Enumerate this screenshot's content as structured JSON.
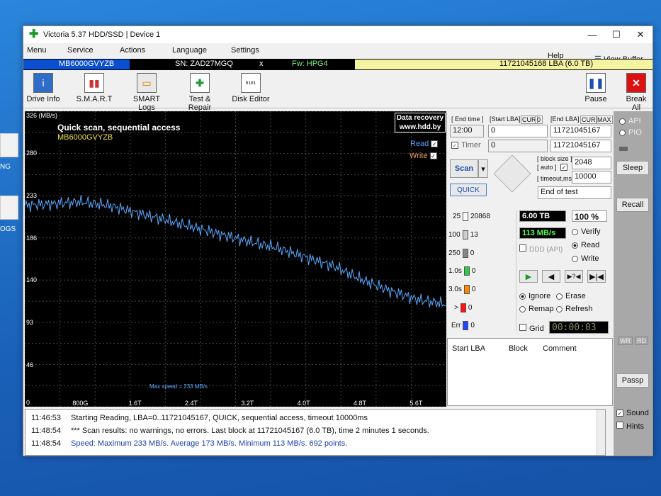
{
  "desktop": {
    "icon1_label": "NG",
    "icon2_label": "OGS"
  },
  "window": {
    "title": "Victoria 5.37 HDD/SSD | Device 1",
    "min": "—",
    "max": "☐",
    "close": "✕"
  },
  "menu": {
    "items": [
      "Menu",
      "Service",
      "Actions",
      "Language",
      "Settings"
    ],
    "help": "Help",
    "view_buffer": "View Buffer Live"
  },
  "info": {
    "model": "MB6000GVYZB",
    "sn": "SN: ZAD27MGQ",
    "x": "x",
    "fw": "Fw: HPG4",
    "lba": "11721045168 LBA (6.0 TB)"
  },
  "toolbar": {
    "drive_info": "Drive Info",
    "smart": "S.M.A.R.T",
    "smart_logs": "SMART Logs",
    "test_repair": "Test & Repair",
    "disk_editor": "Disk Editor",
    "pause": "Pause",
    "break_all": "Break All"
  },
  "graph": {
    "ymax": "326 (MB/s)",
    "yticks": [
      "280",
      "233",
      "186",
      "140",
      "93",
      "46",
      "0"
    ],
    "xticks": [
      "800G",
      "1.6T",
      "2.4T",
      "3.2T",
      "4.0T",
      "4.8T",
      "5.6T"
    ],
    "scan_title": "Quick scan, sequential access",
    "model": "MB6000GVYZB",
    "recovery1": "Data recovery",
    "recovery2": "www.hdd.by",
    "read": "Read",
    "write": "Write",
    "max_speed": "Max speed = 233 MB/s"
  },
  "chart_data": {
    "type": "line",
    "xlabel": "",
    "ylabel": "(MB/s)",
    "ylim": [
      0,
      326
    ],
    "xlim": [
      0,
      6.0
    ],
    "series": [
      {
        "values": [
          [
            0,
            222
          ],
          [
            0.4,
            224
          ],
          [
            0.8,
            226
          ],
          [
            1.2,
            222
          ],
          [
            1.6,
            214
          ],
          [
            2.0,
            206
          ],
          [
            2.4,
            198
          ],
          [
            2.8,
            190
          ],
          [
            3.2,
            182
          ],
          [
            3.6,
            175
          ],
          [
            4.0,
            165
          ],
          [
            4.4,
            155
          ],
          [
            4.8,
            140
          ],
          [
            5.2,
            128
          ],
          [
            5.6,
            118
          ],
          [
            6.0,
            113
          ]
        ]
      }
    ]
  },
  "controls": {
    "end_time": "[ End time ]",
    "start_lba": "[Start LBA]",
    "cur": "CUR",
    "zero": "0",
    "end_lba": "[End LBA]",
    "max": "MAX",
    "time": "12:00",
    "start_val": "0",
    "end_val": "11721045167",
    "timer": "Timer",
    "timer_val": "0",
    "end_val2": "11721045167",
    "block_size": "[ block size ]",
    "auto": "[ auto ]",
    "block_val": "2048",
    "timeout": "[ timeout,ms ]",
    "timeout_val": "10000",
    "scan": "Scan",
    "end_of_test": "End of test",
    "quick": "QUICK"
  },
  "stats": [
    {
      "label": "25",
      "count": "20868",
      "color": "#ffffff"
    },
    {
      "label": "100",
      "count": "13",
      "color": "#cccccc"
    },
    {
      "label": "250",
      "count": "0",
      "color": "#888888"
    },
    {
      "label": "1.0s",
      "count": "0",
      "color": "#2ecc40"
    },
    {
      "label": "3.0s",
      "count": "0",
      "color": "#ff8800"
    },
    {
      "label": ">",
      "count": "0",
      "color": "#ff1111"
    },
    {
      "label": "Err",
      "count": "0",
      "color": "#2244ff"
    }
  ],
  "progress": {
    "size": "6.00 TB",
    "percent": "100",
    "pct_sign": "%",
    "speed": "113 MB/s",
    "ddd": "DDD (API)"
  },
  "modes": {
    "verify": "Verify",
    "read": "Read",
    "write": "Write",
    "ignore": "Ignore",
    "erase": "Erase",
    "remap": "Remap",
    "refresh": "Refresh",
    "grid": "Grid",
    "timer": "00:00:03"
  },
  "table": {
    "start_lba": "Start LBA",
    "block": "Block",
    "comment": "Comment"
  },
  "side": {
    "api": "API",
    "pio": "PIO",
    "sleep": "Sleep",
    "recall": "Recall",
    "wr": "WR",
    "rd": "RD",
    "passp": "Passp",
    "sound": "Sound",
    "hints": "Hints"
  },
  "log": [
    {
      "time": "11:46:53",
      "msg": "Starting Reading, LBA=0..11721045167, QUICK, sequential access, timeout 10000ms",
      "color": "#111111"
    },
    {
      "time": "11:48:54",
      "msg": "*** Scan results: no warnings, no errors. Last block at 11721045167 (6.0 TB), time 2 minutes 1 seconds.",
      "color": "#111111"
    },
    {
      "time": "11:48:54",
      "msg": "Speed: Maximum 233 MB/s. Average 173 MB/s. Minimum 113 MB/s. 692 points.",
      "color": "#1a3fb0"
    }
  ]
}
